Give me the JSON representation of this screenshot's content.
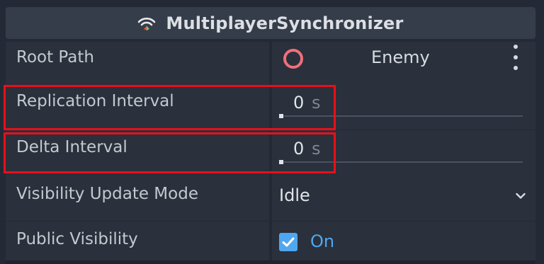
{
  "header": {
    "title": "MultiplayerSynchronizer",
    "icon": "wifi-signal-icon"
  },
  "properties": {
    "root_path": {
      "label": "Root Path",
      "node_name": "Enemy",
      "node_icon": "node-circle-icon",
      "menu_icon": "kebab-menu-icon"
    },
    "replication_interval": {
      "label": "Replication Interval",
      "value": "0",
      "unit": "s",
      "slider_fraction": 0
    },
    "delta_interval": {
      "label": "Delta Interval",
      "value": "0",
      "unit": "s",
      "slider_fraction": 0
    },
    "visibility_update_mode": {
      "label": "Visibility Update Mode",
      "selected": "Idle"
    },
    "public_visibility": {
      "label": "Public Visibility",
      "checked": true,
      "state_label": "On"
    }
  },
  "colors": {
    "accent": "#4fa7ef",
    "highlight": "#e8101a",
    "node_icon": "#f0707a",
    "background": "#242a35",
    "header_bg": "#353d4a"
  }
}
